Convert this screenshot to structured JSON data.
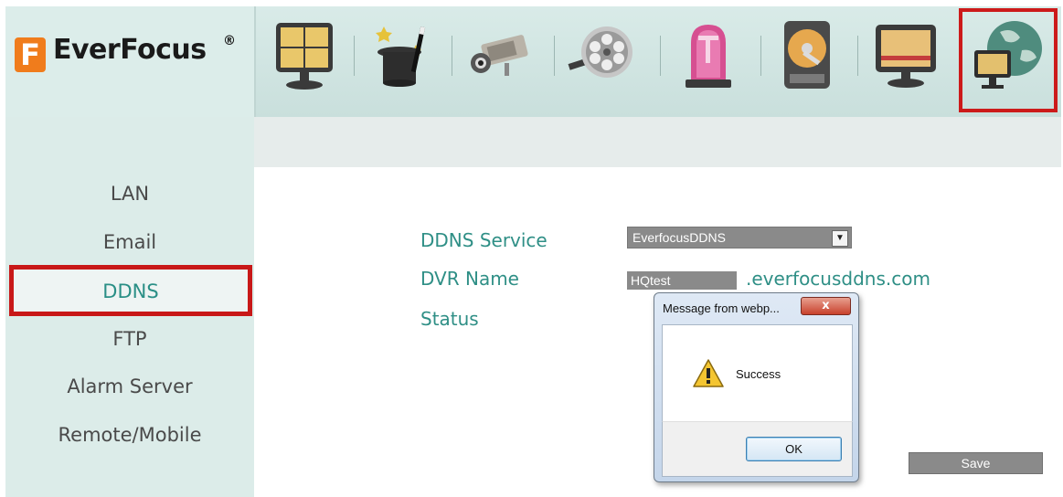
{
  "header": {
    "logo_mark": "F",
    "logo_text": "EverFocus",
    "logo_reg": "®",
    "nav_icons": [
      "monitor-grid-icon",
      "magic-hat-icon",
      "camera-icon",
      "film-reel-icon",
      "alarm-light-icon",
      "hard-disk-icon",
      "display-icon",
      "network-globe-icon"
    ],
    "highlight_color": "#cc1a1a"
  },
  "sidebar": {
    "items": [
      {
        "label": "LAN"
      },
      {
        "label": "Email"
      },
      {
        "label": "DDNS"
      },
      {
        "label": "FTP"
      },
      {
        "label": "Alarm Server"
      },
      {
        "label": "Remote/Mobile"
      }
    ],
    "selected": "DDNS"
  },
  "form": {
    "service_label": "DDNS Service",
    "service_value": "EverfocusDDNS",
    "name_label": "DVR Name",
    "name_value": "HQtest",
    "name_suffix": ".everfocusddns.com",
    "status_label": "Status",
    "save_label": "Save"
  },
  "dialog": {
    "title": "Message from webp...",
    "close_label": "x",
    "message": "Success",
    "ok_label": "OK"
  },
  "colors": {
    "accent_text": "#2f8f86",
    "panel_bg": "#dcece9",
    "input_bg": "#8a8a8a"
  }
}
